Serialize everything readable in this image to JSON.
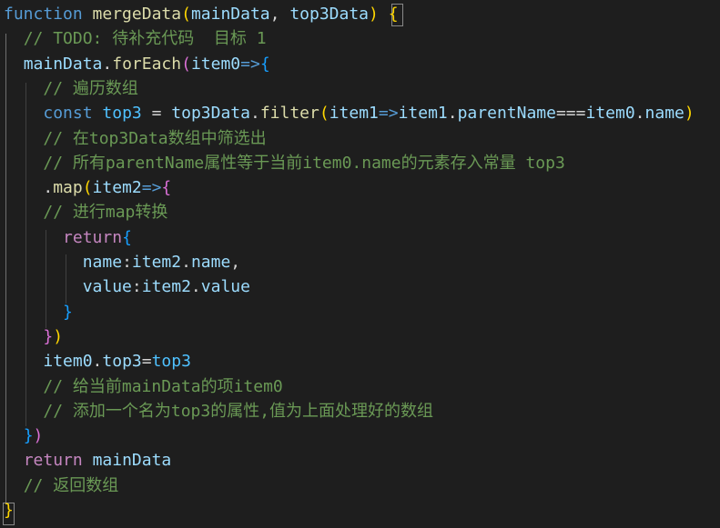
{
  "colors": {
    "background": "#1e1e1e",
    "keyword": "#569cd6",
    "control_keyword": "#c586c0",
    "function": "#dcdcaa",
    "variable": "#9cdcfe",
    "constant": "#4fc1ff",
    "number": "#b5cea8",
    "comment": "#6a9955",
    "bracket_level1": "#ffd700",
    "bracket_level2": "#da70d6",
    "bracket_level3": "#179fff",
    "plain": "#d4d4d4"
  },
  "code": [
    [
      [
        "kw-blue",
        "function"
      ],
      [
        "txt",
        " "
      ],
      [
        "fn",
        "mergeData"
      ],
      [
        "br1",
        "("
      ],
      [
        "var",
        "mainData"
      ],
      [
        "txt",
        ", "
      ],
      [
        "var",
        "top3Data"
      ],
      [
        "br1",
        ")"
      ],
      [
        "txt",
        " "
      ],
      [
        "br1",
        "{"
      ]
    ],
    [
      [
        "txt",
        "  "
      ],
      [
        "cmt",
        "// TODO: 待补充代码  目标 1"
      ]
    ],
    [
      [
        "txt",
        "  "
      ],
      [
        "var",
        "mainData"
      ],
      [
        "txt",
        "."
      ],
      [
        "fn",
        "forEach"
      ],
      [
        "br2",
        "("
      ],
      [
        "var",
        "item0"
      ],
      [
        "kw-blue",
        "=>"
      ],
      [
        "br3",
        "{"
      ]
    ],
    [
      [
        "txt",
        "    "
      ],
      [
        "cmt",
        "// 遍历数组"
      ]
    ],
    [
      [
        "txt",
        "    "
      ],
      [
        "kw-blue",
        "const"
      ],
      [
        "txt",
        " "
      ],
      [
        "const",
        "top3"
      ],
      [
        "txt",
        " = "
      ],
      [
        "var",
        "top3Data"
      ],
      [
        "txt",
        "."
      ],
      [
        "fn",
        "filter"
      ],
      [
        "br1",
        "("
      ],
      [
        "var",
        "item1"
      ],
      [
        "kw-blue",
        "=>"
      ],
      [
        "var",
        "item1"
      ],
      [
        "txt",
        "."
      ],
      [
        "var",
        "parentName"
      ],
      [
        "txt",
        "==="
      ],
      [
        "var",
        "item0"
      ],
      [
        "txt",
        "."
      ],
      [
        "var",
        "name"
      ],
      [
        "br1",
        ")"
      ]
    ],
    [
      [
        "txt",
        "    "
      ],
      [
        "cmt",
        "// 在top3Data数组中筛选出"
      ]
    ],
    [
      [
        "txt",
        "    "
      ],
      [
        "cmt",
        "// 所有parentName属性等于当前item0.name的元素存入常量 top3"
      ]
    ],
    [
      [
        "txt",
        "    ."
      ],
      [
        "fn",
        "map"
      ],
      [
        "br1",
        "("
      ],
      [
        "var",
        "item2"
      ],
      [
        "kw-blue",
        "=>"
      ],
      [
        "br2",
        "{"
      ]
    ],
    [
      [
        "txt",
        "    "
      ],
      [
        "cmt",
        "// 进行map转换"
      ]
    ],
    [
      [
        "txt",
        "      "
      ],
      [
        "kw-ctrl",
        "return"
      ],
      [
        "br3",
        "{"
      ]
    ],
    [
      [
        "txt",
        "        "
      ],
      [
        "var",
        "name"
      ],
      [
        "txt",
        ":"
      ],
      [
        "var",
        "item2"
      ],
      [
        "txt",
        "."
      ],
      [
        "var",
        "name"
      ],
      [
        "txt",
        ","
      ]
    ],
    [
      [
        "txt",
        "        "
      ],
      [
        "var",
        "value"
      ],
      [
        "txt",
        ":"
      ],
      [
        "var",
        "item2"
      ],
      [
        "txt",
        "."
      ],
      [
        "var",
        "value"
      ]
    ],
    [
      [
        "txt",
        "      "
      ],
      [
        "br3",
        "}"
      ]
    ],
    [
      [
        "txt",
        "    "
      ],
      [
        "br2",
        "}"
      ],
      [
        "br1",
        ")"
      ]
    ],
    [
      [
        "txt",
        "    "
      ],
      [
        "var",
        "item0"
      ],
      [
        "txt",
        "."
      ],
      [
        "var",
        "top3"
      ],
      [
        "txt",
        "="
      ],
      [
        "const",
        "top3"
      ]
    ],
    [
      [
        "txt",
        "    "
      ],
      [
        "cmt",
        "// 给当前mainData的项item0"
      ]
    ],
    [
      [
        "txt",
        "    "
      ],
      [
        "cmt",
        "// 添加一个名为top3的属性,值为上面处理好的数组"
      ]
    ],
    [
      [
        "txt",
        "  "
      ],
      [
        "br3",
        "}"
      ],
      [
        "br2",
        ")"
      ]
    ],
    [
      [
        "txt",
        "  "
      ],
      [
        "kw-ctrl",
        "return"
      ],
      [
        "txt",
        " "
      ],
      [
        "var",
        "mainData"
      ]
    ],
    [
      [
        "txt",
        "  "
      ],
      [
        "cmt",
        "// 返回数组"
      ]
    ],
    [
      [
        "br1",
        "}"
      ]
    ]
  ]
}
